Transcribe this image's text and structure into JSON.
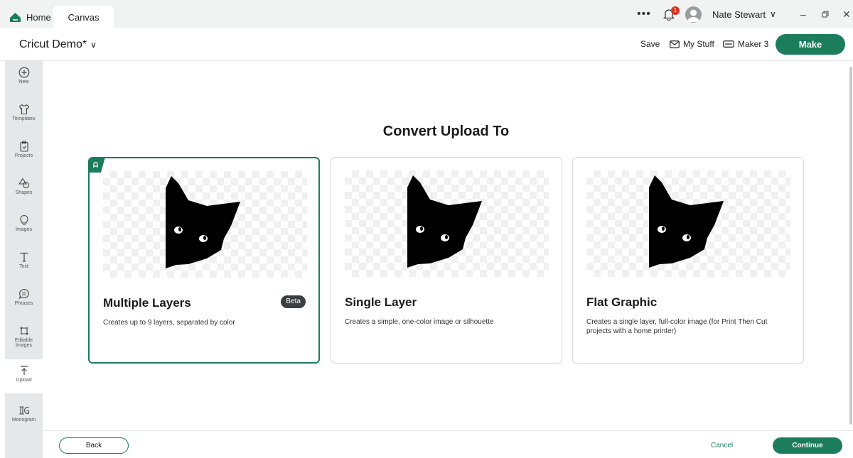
{
  "tabs": {
    "home": "Home",
    "canvas": "Canvas"
  },
  "topbar": {
    "more": "•••",
    "notifications_count": "1",
    "user_name": "Nate Stewart"
  },
  "header": {
    "project_title": "Cricut Demo*",
    "save": "Save",
    "my_stuff": "My Stuff",
    "machine": "Maker 3",
    "make": "Make"
  },
  "sidebar": {
    "items": [
      {
        "label": "New",
        "icon": "plus-circle-icon"
      },
      {
        "label": "Templates",
        "icon": "shirt-icon"
      },
      {
        "label": "Projects",
        "icon": "clipboard-icon"
      },
      {
        "label": "Shapes",
        "icon": "shapes-icon"
      },
      {
        "label": "Images",
        "icon": "lightbulb-icon"
      },
      {
        "label": "Text",
        "icon": "text-icon"
      },
      {
        "label": "Phrases",
        "icon": "speech-bubble-icon"
      },
      {
        "label": "Editable",
        "label2": "Images",
        "icon": "editable-images-icon"
      },
      {
        "label": "Upload",
        "icon": "upload-icon"
      },
      {
        "label": "Monogram",
        "icon": "monogram-icon"
      }
    ]
  },
  "main": {
    "heading": "Convert Upload To",
    "options": [
      {
        "title": "Multiple Layers",
        "badge": "Beta",
        "desc": "Creates up to 9 layers, separated by color",
        "selected": true
      },
      {
        "title": "Single Layer",
        "desc": "Creates a simple, one-color image or silhouette",
        "selected": false
      },
      {
        "title": "Flat Graphic",
        "desc": "Creates a single layer, full-color image (for Print Then Cut projects with a home printer)",
        "selected": false
      }
    ]
  },
  "footer": {
    "back": "Back",
    "cancel": "Cancel",
    "continue": "Continue"
  },
  "colors": {
    "brand_green": "#1b7d5c",
    "sidebar_bg": "#e6e7e8",
    "badge_red": "#d9341f"
  }
}
